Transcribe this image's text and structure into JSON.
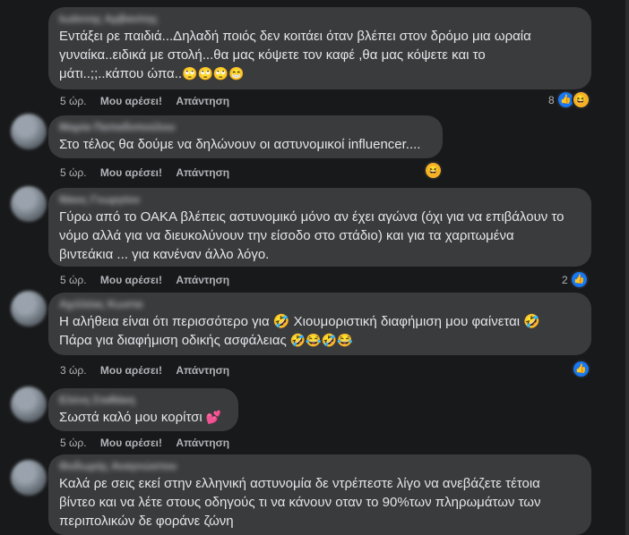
{
  "comments": [
    {
      "author": "Ιωάννης Αρβανίτης",
      "lines": [
        "Εντάξει ρε παιδιά...Δηλαδή ποιός δεν κοιτάει όταν βλέπει στον δρόμο μια ωραία",
        "γυναίκα..ειδικά με στολή...θα μας κόψετε τον καφέ ,θα μας κόψετε και το",
        "μάτι..;;..κάπου ώπα.."
      ],
      "emoji": "🙄🙄🙄😁",
      "time": "5 ώρ.",
      "like": "Μου αρέσει!",
      "reply": "Απάντηση",
      "reaction_count": "8"
    },
    {
      "author": "Μαρία Παπαδοπούλου",
      "lines": [
        "Στο τέλος θα δούμε να δηλώνουν οι αστυνομικοί influencer...."
      ],
      "emoji": "",
      "time": "5 ώρ.",
      "like": "Μου αρέσει!",
      "reply": "Απάντηση",
      "reaction_count": ""
    },
    {
      "author": "Νίκος Γεωργίου",
      "lines": [
        "Γύρω από το ΟΑΚΑ βλέπεις αστυνομικό μόνο αν έχει αγώνα (όχι για να επιβάλουν το",
        "νόμο αλλά για να διευκολύνουν την είσοδο στο στάδιο) και για τα χαριτωμένα",
        "βιντεάκια ... για κανέναν άλλο λόγο."
      ],
      "emoji": "",
      "time": "5 ώρ.",
      "like": "Μου αρέσει!",
      "reply": "Απάντηση",
      "reaction_count": "2"
    },
    {
      "author": "Αχιλλέας Κωστα",
      "lines": [
        "Η αλήθεια είναι ότι περισσότερο για 🤣 Χιουμοριστική διαφήμιση μου φαίνεται 🤣",
        "Πάρα για διαφήμιση οδικής ασφάλειας"
      ],
      "emoji": "🤣😂🤣😂",
      "time": "3 ώρ.",
      "like": "Μου αρέσει!",
      "reply": "Απάντηση",
      "reaction_count": ""
    },
    {
      "author": "Ελένη Σταθάκη",
      "lines": [
        "Σωστά καλό μου κορίτσι"
      ],
      "emoji": "💕",
      "time": "5 ώρ.",
      "like": "Μου αρέσει!",
      "reply": "Απάντηση",
      "reaction_count": ""
    },
    {
      "author": "Θοδωρής Αναγνώστου",
      "lines": [
        "Καλά ρε σεις εκεί στην ελληνική αστυνομία δε ντρέπεστε λίγο να ανεβάζετε τέτοια",
        "βίντεο και να λέτε στους οδηγούς τι να κάνουν οταν το 90%των πληρωμάτων των",
        "περιπολικών δε φοράνε ζώνη"
      ],
      "emoji": "",
      "time": "",
      "like": "",
      "reply": "",
      "reaction_count": ""
    }
  ],
  "icons": {
    "like": "like-icon",
    "haha": "haha-icon"
  }
}
